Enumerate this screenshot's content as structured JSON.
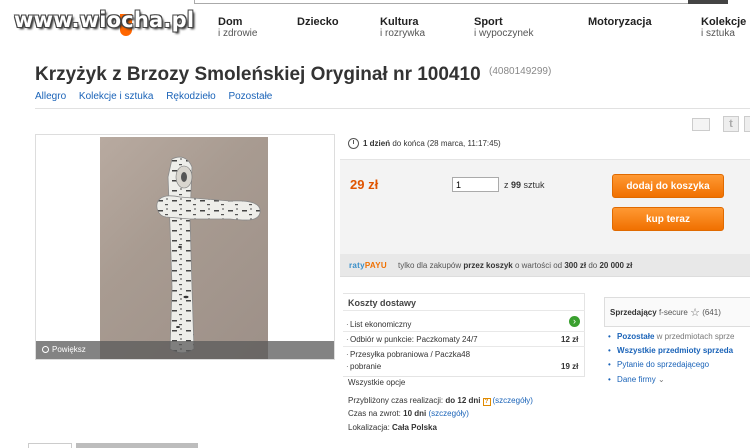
{
  "watermark": "www.wiocha.pl",
  "nav": {
    "items": [
      {
        "title": "Dom",
        "sub": "i zdrowie"
      },
      {
        "title": "Dziecko",
        "sub": ""
      },
      {
        "title": "Kultura",
        "sub": "i rozrywka"
      },
      {
        "title": "Sport",
        "sub": "i wypoczynek"
      },
      {
        "title": "Motoryzacja",
        "sub": ""
      },
      {
        "title": "Kolekcje",
        "sub": "i sztuka"
      }
    ]
  },
  "offer": {
    "title": "Krzyżyk z Brzozy Smoleńskiej Oryginał nr 100410",
    "id": "(4080149299)"
  },
  "breadcrumb": [
    "Allegro",
    "Kolekcje i sztuka",
    "Rękodzieło",
    "Pozostałe"
  ],
  "image": {
    "zoom_label": "Powiększ"
  },
  "time": {
    "remaining": "1 dzień",
    "rest": " do końca (28 marca, 11:17:45)"
  },
  "price": {
    "value": "29 zł",
    "qty_value": "1",
    "qty_prefix": "z ",
    "qty_total": "99",
    "qty_unit": " sztuk",
    "add_to_cart": "dodaj do koszyka",
    "buy_now": "kup teraz"
  },
  "raty": {
    "logo_a": "raty",
    "logo_b": "PAYU",
    "text_a": "tylko dla zakupów ",
    "text_b": "przez koszyk",
    "text_c": " o wartości od ",
    "min": "300 zł",
    "text_d": " do ",
    "max": "20 000 zł"
  },
  "shipping": {
    "title": "Koszty dostawy",
    "rows": [
      {
        "label": "List ekonomiczny",
        "value": ""
      },
      {
        "label": "Odbiór w punkcie: Paczkomaty 24/7",
        "value": "12 zł"
      },
      {
        "label": "Przesyłka pobraniowa / Paczka48",
        "label2": "pobranie",
        "value": "19 zł"
      }
    ],
    "all_options": "Wszystkie opcje",
    "realization_label": "Przybliżony czas realizacji: ",
    "realization_value": "do 12 dni",
    "details": "(szczegóły)",
    "return_label": "Czas na zwrot: ",
    "return_value": "10 dni",
    "location_label": "Lokalizacja: ",
    "location_value": "Cała Polska"
  },
  "seller": {
    "label": "Sprzedający",
    "name": "f-secure",
    "rating": "(641)",
    "links": [
      {
        "bold": "Pozostałe",
        "rest": " w przedmiotach sprze"
      },
      {
        "bold": "Wszystkie przedmioty sprzeda",
        "rest": ""
      },
      {
        "bold": "",
        "rest": "Pytanie do sprzedającego"
      },
      {
        "bold": "",
        "rest": "Dane firmy"
      }
    ]
  },
  "colors": {
    "accent": "#f07000",
    "link": "#1a63b8",
    "price": "#e05400"
  }
}
